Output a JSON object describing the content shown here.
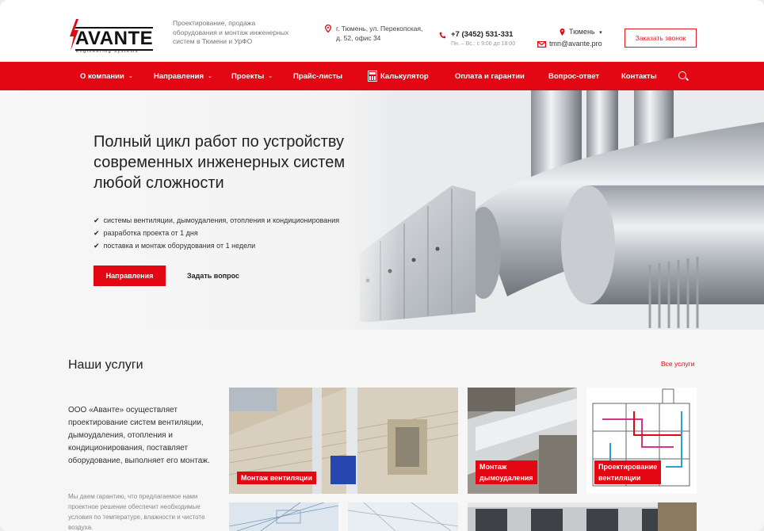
{
  "header": {
    "logo_text": "AVANTE",
    "logo_sub": "engineering systems",
    "tagline": "Проектирование, продажа оборудования и монтаж инженерных систем в Тюмени и УрФО",
    "address": "г. Тюмень, ул. Перекопская, д. 52, офис 34",
    "phone": "+7 (3452) 531-331",
    "hours": "Пн. – Вс.: с 9:00 до 18:00",
    "city": "Тюмень",
    "email": "tmn@avante.pro",
    "callback_label": "Заказать звонок"
  },
  "nav": {
    "items": [
      {
        "label": "О компании"
      },
      {
        "label": "Направления"
      },
      {
        "label": "Проекты"
      },
      {
        "label": "Прайс-листы"
      },
      {
        "label": "Калькулятор"
      },
      {
        "label": "Оплата и гарантии"
      },
      {
        "label": "Вопрос-ответ"
      },
      {
        "label": "Контакты"
      }
    ]
  },
  "hero": {
    "title": "Полный цикл работ по устройству современных инженерных систем любой сложности",
    "bullets": [
      "системы вентиляции, дымоудаления, отопления и кондиционирования",
      "разработка проекта от 1 дня",
      "поставка и монтаж оборудования от 1 недели"
    ],
    "primary_button": "Направления",
    "secondary_button": "Задать вопрос"
  },
  "services": {
    "title": "Наши услуги",
    "all_link": "Все услуги",
    "lead": "ООО «Аванте» осуществляет проектирование систем вентиляции, дымоудаления, отопления и кондиционирования, поставляет оборудование, выполняет его монтаж.",
    "note": "Мы даем гарантию, что предлагаемое нами проектное решение обеспечит необходимые условия по температуре, влажности и чистоте воздуха.",
    "tiles": [
      {
        "label": "Монтаж вентиляции"
      },
      {
        "label_line1": "Монтаж",
        "label_line2": "дымоудаления"
      },
      {
        "label_line1": "Проектирование",
        "label_line2": "вентиляции"
      }
    ]
  },
  "colors": {
    "accent": "#e30613",
    "text": "#222222",
    "muted": "#888888"
  }
}
